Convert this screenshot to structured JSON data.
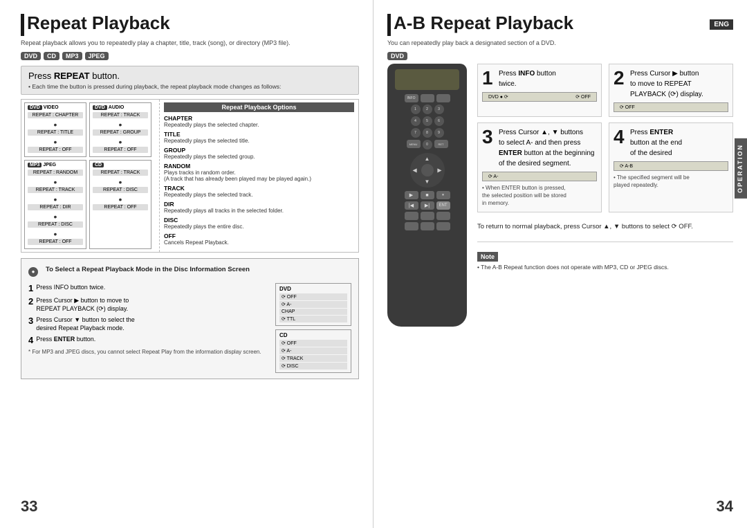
{
  "left": {
    "title": "Repeat Playback",
    "subtitle": "Repeat playback allows you to repeatedly play a chapter, title, track (song), or directory (MP3 file).",
    "formats": [
      "DVD",
      "CD",
      "MP3",
      "JPEG"
    ],
    "press_repeat_label": "Press ",
    "press_repeat_bold": "REPEAT",
    "press_repeat_suffix": " button.",
    "press_repeat_note": "• Each time the button is pressed during playback, the repeat playback mode changes as follows:",
    "repeat_options_title": "Repeat Playback Options",
    "options": [
      {
        "name": "CHAPTER",
        "desc": "Repeatedly plays the selected chapter."
      },
      {
        "name": "TITLE",
        "desc": "Repeatedly plays the selected title."
      },
      {
        "name": "GROUP",
        "desc": "Repeatedly plays the selected group."
      },
      {
        "name": "RANDOM",
        "desc": "Plays tracks in random order.\n(A track that has already been played may be played again.)"
      },
      {
        "name": "TRACK",
        "desc": "Repeatedly plays the selected track."
      },
      {
        "name": "DIR",
        "desc": "Repeatedly plays all tracks in the selected folder."
      },
      {
        "name": "DISC",
        "desc": "Repeatedly plays the entire disc."
      },
      {
        "name": "OFF",
        "desc": "Cancels Repeat Playback."
      }
    ],
    "dvd_video_options": [
      "REPEAT : CHAPTER",
      "REPEAT : TITLE",
      "REPEAT : OFF"
    ],
    "dvd_audio_options": [
      "REPEAT : TRACK",
      "REPEAT : GROUP",
      "REPEAT : OFF"
    ],
    "mp3_jpeg_options": [
      "REPEAT : RANDOM",
      "REPEAT : TRACK",
      "REPEAT : DIR",
      "REPEAT : DISC",
      "REPEAT : OFF"
    ],
    "cd_options": [
      "REPEAT : TRACK",
      "REPEAT : DISC",
      "REPEAT : OFF"
    ],
    "info_box_title": "To Select a Repeat Playback Mode in the Disc Information Screen",
    "steps": [
      {
        "num": "1",
        "text": "Press INFO button twice."
      },
      {
        "num": "2",
        "text": "Press Cursor ▶ button to move to REPEAT PLAYBACK (⟳) display."
      },
      {
        "num": "3",
        "text": "Press Cursor ▼ button to select the desired Repeat Playback mode."
      },
      {
        "num": "4",
        "text": "Press ENTER button."
      }
    ],
    "footnote": "* For MP3 and JPEG discs, you cannot select Repeat Play from the information display screen.",
    "page_number": "33"
  },
  "right": {
    "title": "A-B Repeat Playback",
    "eng_badge": "ENG",
    "subtitle": "You can repeatedly play back a designated section of a DVD.",
    "format_badge": "DVD",
    "steps": [
      {
        "num": "1",
        "text": "Press INFO button twice."
      },
      {
        "num": "2",
        "text": "Press Cursor ▶ button to move to REPEAT PLAYBACK (⟳) display."
      },
      {
        "num": "3",
        "text": "Press Cursor ▲, ▼ buttons to select A- and then press ENTER button at the beginning of the desired segment."
      },
      {
        "num": "4",
        "text": "Press ENTER button at the end of the desired"
      }
    ],
    "note3_bullet": "• When ENTER button is pressed, the selected position will be stored in memory.",
    "note4_bullet": "• The specified segment will be played repeatedly.",
    "return_note": "To return to normal playback, press Cursor ▲, ▼ buttons to select ⟳ OFF.",
    "note_label": "Note",
    "note_text": "• The A-B Repeat function does not operate with MP3, CD or JPEG discs.",
    "display_repeat_a": "REPEAT : A-",
    "display_repeat_ab": "REPEAT : A-B",
    "display_repeat_a_only": "REPEAT : A-",
    "operation_label": "OPERATION",
    "page_number": "34"
  }
}
